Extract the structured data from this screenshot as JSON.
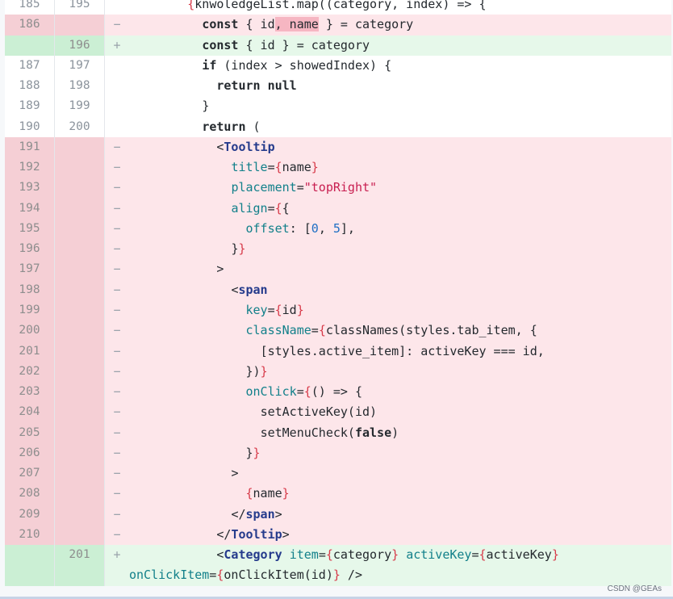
{
  "lines": [
    {
      "old": "185",
      "new": "195",
      "sign": "",
      "type": "ctx"
    },
    {
      "old": "186",
      "new": "",
      "sign": "−",
      "type": "del"
    },
    {
      "old": "",
      "new": "196",
      "sign": "+",
      "type": "add"
    },
    {
      "old": "187",
      "new": "197",
      "sign": "",
      "type": "ctx"
    },
    {
      "old": "188",
      "new": "198",
      "sign": "",
      "type": "ctx"
    },
    {
      "old": "189",
      "new": "199",
      "sign": "",
      "type": "ctx"
    },
    {
      "old": "190",
      "new": "200",
      "sign": "",
      "type": "ctx"
    },
    {
      "old": "191",
      "new": "",
      "sign": "−",
      "type": "del"
    },
    {
      "old": "192",
      "new": "",
      "sign": "−",
      "type": "del"
    },
    {
      "old": "193",
      "new": "",
      "sign": "−",
      "type": "del"
    },
    {
      "old": "194",
      "new": "",
      "sign": "−",
      "type": "del"
    },
    {
      "old": "195",
      "new": "",
      "sign": "−",
      "type": "del"
    },
    {
      "old": "196",
      "new": "",
      "sign": "−",
      "type": "del"
    },
    {
      "old": "197",
      "new": "",
      "sign": "−",
      "type": "del"
    },
    {
      "old": "198",
      "new": "",
      "sign": "−",
      "type": "del"
    },
    {
      "old": "199",
      "new": "",
      "sign": "−",
      "type": "del"
    },
    {
      "old": "200",
      "new": "",
      "sign": "−",
      "type": "del"
    },
    {
      "old": "201",
      "new": "",
      "sign": "−",
      "type": "del"
    },
    {
      "old": "202",
      "new": "",
      "sign": "−",
      "type": "del"
    },
    {
      "old": "203",
      "new": "",
      "sign": "−",
      "type": "del"
    },
    {
      "old": "204",
      "new": "",
      "sign": "−",
      "type": "del"
    },
    {
      "old": "205",
      "new": "",
      "sign": "−",
      "type": "del"
    },
    {
      "old": "206",
      "new": "",
      "sign": "−",
      "type": "del"
    },
    {
      "old": "207",
      "new": "",
      "sign": "−",
      "type": "del"
    },
    {
      "old": "208",
      "new": "",
      "sign": "−",
      "type": "del"
    },
    {
      "old": "209",
      "new": "",
      "sign": "−",
      "type": "del"
    },
    {
      "old": "210",
      "new": "",
      "sign": "−",
      "type": "del"
    },
    {
      "old": "",
      "new": "201",
      "sign": "+",
      "type": "add"
    }
  ],
  "code": {
    "l0_indent": "        ",
    "l0_brace": "{",
    "l0_text": "knwoledgeList.map((category, index) => {",
    "l1_indent": "          ",
    "l1_kw": "const",
    "l1_a": " { id",
    "l1_hl": ", name",
    "l1_b": " } = category",
    "l2_indent": "          ",
    "l2_kw": "const",
    "l2_a": " { id } = category",
    "l3_indent": "          ",
    "l3_kw": "if",
    "l3_a": " (index > showedIndex) {",
    "l4_indent": "            ",
    "l4_kw": "return null",
    "l5_indent": "          ",
    "l5_a": "}",
    "l6_indent": "          ",
    "l6_kw": "return",
    "l6_a": " (",
    "l7_indent": "            ",
    "l7_lt": "<",
    "l7_tag": "Tooltip",
    "l8_indent": "              ",
    "l8_attr": "title",
    "l8_eq": "=",
    "l8_ob": "{",
    "l8_v": "name",
    "l8_cb": "}",
    "l9_indent": "              ",
    "l9_attr": "placement",
    "l9_eq": "=",
    "l9_str": "\"topRight\"",
    "l10_indent": "              ",
    "l10_attr": "align",
    "l10_eq": "=",
    "l10_ob": "{",
    "l10_v": "{",
    "l11_indent": "                ",
    "l11_attr": "offset",
    "l11_a": ": [",
    "l11_n1": "0",
    "l11_b": ", ",
    "l11_n2": "5",
    "l11_c": "],",
    "l12_indent": "              ",
    "l12_a": "}",
    "l12_cb": "}",
    "l13_indent": "            ",
    "l13_a": ">",
    "l14_indent": "              ",
    "l14_lt": "<",
    "l14_tag": "span",
    "l15_indent": "                ",
    "l15_attr": "key",
    "l15_eq": "=",
    "l15_ob": "{",
    "l15_v": "id",
    "l15_cb": "}",
    "l16_indent": "                ",
    "l16_attr": "className",
    "l16_eq": "=",
    "l16_ob": "{",
    "l16_v": "classNames(styles.tab_item, {",
    "l17_indent": "                  ",
    "l17_a": "[styles.active_item]: activeKey === id,",
    "l18_indent": "                ",
    "l18_a": "})",
    "l18_cb": "}",
    "l19_indent": "                ",
    "l19_attr": "onClick",
    "l19_eq": "=",
    "l19_ob": "{",
    "l19_v": "() => {",
    "l20_indent": "                  ",
    "l20_a": "setActiveKey(id)",
    "l21_indent": "                  ",
    "l21_a": "setMenuCheck(",
    "l21_kw": "false",
    "l21_b": ")",
    "l22_indent": "                ",
    "l22_a": "}",
    "l22_cb": "}",
    "l23_indent": "              ",
    "l23_a": ">",
    "l24_indent": "                ",
    "l24_ob": "{",
    "l24_v": "name",
    "l24_cb": "}",
    "l25_indent": "              ",
    "l25_a": "</",
    "l25_tag": "span",
    "l25_b": ">",
    "l26_indent": "            ",
    "l26_a": "</",
    "l26_tag": "Tooltip",
    "l26_b": ">",
    "l27_indent": "            ",
    "l27_lt": "<",
    "l27_tag": "Category",
    "l27_sp1": " ",
    "l27_attr1": "item",
    "l27_eq1": "=",
    "l27_ob1": "{",
    "l27_v1": "category",
    "l27_cb1": "}",
    "l27_sp2": " ",
    "l27_attr2": "activeKey",
    "l27_eq2": "=",
    "l27_ob2": "{",
    "l27_v2": "activeKey",
    "l27_cb2": "}",
    "l27_sp3": "\n",
    "l27_attr3": "onClickItem",
    "l27_eq3": "=",
    "l27_ob3": "{",
    "l27_v3": "onClickItem(id)",
    "l27_cb3": "}",
    "l27_end": " />"
  },
  "watermark": "CSDN @GEAs"
}
